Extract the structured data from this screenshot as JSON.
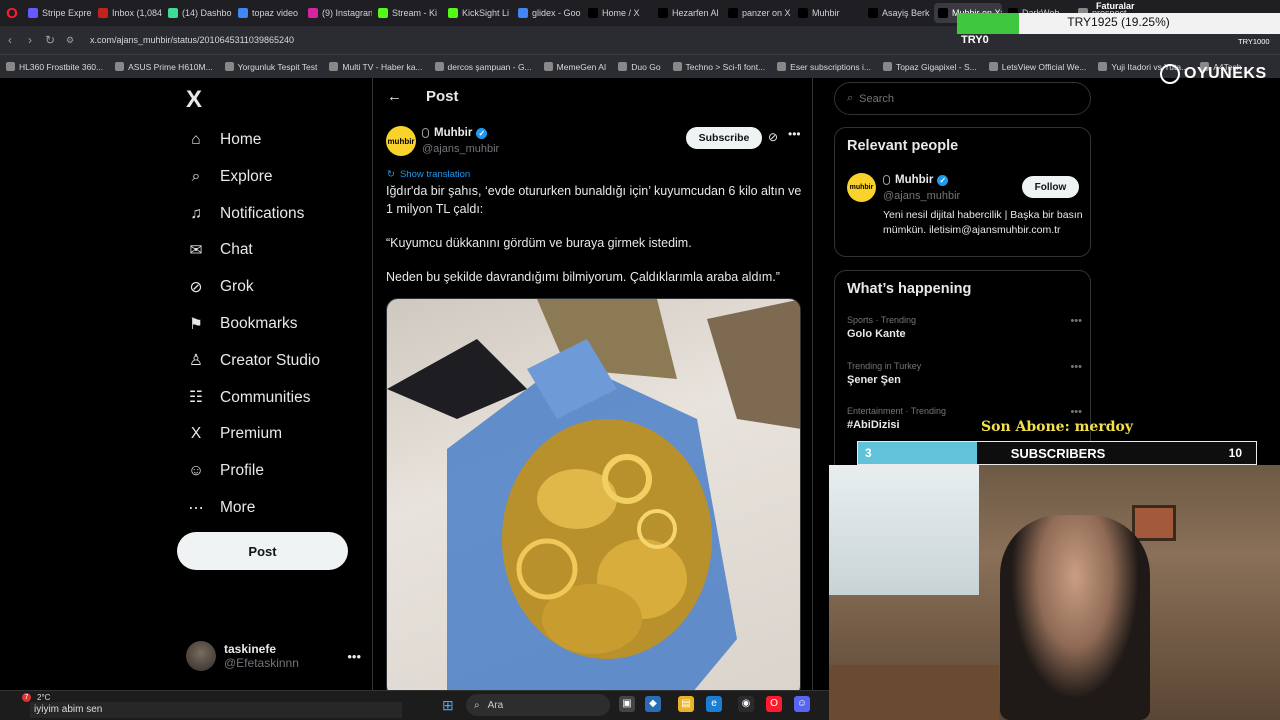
{
  "browser": {
    "tabs": [
      {
        "label": "Stripe Expre",
        "color": "#635bff"
      },
      {
        "label": "Inbox (1,084",
        "color": "#c5221f"
      },
      {
        "label": "(14) Dashbo",
        "color": "#3ddc97"
      },
      {
        "label": "topaz video",
        "color": "#4285f4"
      },
      {
        "label": "(9) Instagran",
        "color": "#d6249f"
      },
      {
        "label": "Stream - Ki",
        "color": "#53fc18"
      },
      {
        "label": "KickSight Li",
        "color": "#53fc18"
      },
      {
        "label": "glidex - Goo",
        "color": "#4285f4"
      },
      {
        "label": "Home / X",
        "color": "#000000"
      },
      {
        "label": "Hezarfen Al",
        "color": "#000000"
      },
      {
        "label": "panzer on X",
        "color": "#000000"
      },
      {
        "label": "Muhbir",
        "color": "#000000"
      },
      {
        "label": "Asayiş Berk",
        "color": "#000000"
      },
      {
        "label": "Muhbir on X: \"Iğ",
        "color": "#000000",
        "active": true
      },
      {
        "label": "DarkWeb",
        "color": "#000000"
      },
      {
        "label": "prospect",
        "color": "#888888"
      }
    ],
    "url": "x.com/ajans_muhbir/status/2010645311039865240",
    "bookmarks": [
      "HL360 Frostbite 360...",
      "ASUS Prime H610M...",
      "Yorgunluk Tespit Test",
      "Multi TV - Haber ka...",
      "dercos şampuan - G...",
      "MemeGen AI",
      "Duo Go",
      "Techno > Sci-fi font...",
      "Eser subscriptions i...",
      "Topaz Gigapixel - S...",
      "LetsView Official We...",
      "Yuji Itadori vs Yuta...",
      "A4Tech"
    ]
  },
  "nav": {
    "logo": "X",
    "items": [
      {
        "label": "Home",
        "icon": "home-icon",
        "glyph": "⌂"
      },
      {
        "label": "Explore",
        "icon": "search-icon",
        "glyph": "⌕"
      },
      {
        "label": "Notifications",
        "icon": "bell-icon",
        "glyph": "♫"
      },
      {
        "label": "Chat",
        "icon": "mail-icon",
        "glyph": "✉"
      },
      {
        "label": "Grok",
        "icon": "grok-icon",
        "glyph": "⊘"
      },
      {
        "label": "Bookmarks",
        "icon": "bookmark-icon",
        "glyph": "⚑"
      },
      {
        "label": "Creator Studio",
        "icon": "creator-studio-icon",
        "glyph": "♙"
      },
      {
        "label": "Communities",
        "icon": "communities-icon",
        "glyph": "☷"
      },
      {
        "label": "Premium",
        "icon": "premium-icon",
        "glyph": "X"
      },
      {
        "label": "Profile",
        "icon": "profile-icon",
        "glyph": "☺"
      },
      {
        "label": "More",
        "icon": "more-circle-icon",
        "glyph": "⋯"
      }
    ],
    "post_label": "Post",
    "account": {
      "name": "taskinefe",
      "handle": "@Efetaskinnn"
    }
  },
  "post": {
    "header": "Post",
    "author": {
      "avatar_text": "muhbir",
      "name": "Muhbir",
      "handle": "@ajans_muhbir"
    },
    "subscribe_label": "Subscribe",
    "show_translation": "Show translation",
    "paragraphs": [
      "Iğdır'da bir şahıs, ‘evde otururken bunaldığı için’ kuyumcudan 6 kilo altın ve 1 milyon TL çaldı:",
      "“Kuyumcu dükkanını gördüm ve buraya girmek istedim.",
      "Neden bu şekilde davrandığımı bilmiyorum. Çaldıklarımla araba aldım.”"
    ]
  },
  "sidebar": {
    "search_placeholder": "Search",
    "relevant_title": "Relevant people",
    "person": {
      "avatar_text": "muhbir",
      "name": "Muhbir",
      "handle": "@ajans_muhbir",
      "follow_label": "Follow",
      "bio": "Yeni nesil dijital habercilik | Başka bir basın mümkün. iletisim@ajansmuhbir.com.tr"
    },
    "happening_title": "What’s happening",
    "trends": [
      {
        "meta": "Sports · Trending",
        "name": "Golo Kante"
      },
      {
        "meta": "Trending in Turkey",
        "name": "Şener Şen"
      },
      {
        "meta": "Entertainment · Trending",
        "name": "#AbiDizisi"
      }
    ]
  },
  "overlay": {
    "try_goal": "TRY1925 (19.25%)",
    "try_goal_fraction": 0.1925,
    "try_current": "TRY0",
    "faturalar": "Faturalar",
    "try_right": "TRY1000",
    "brand": "OYUNEKS",
    "son_abone": "Son Abone: merdoy",
    "subs_current": "3",
    "subs_label": "SUBSCRIBERS",
    "subs_goal": "10",
    "subs_fraction": 0.3
  },
  "taskbar": {
    "weather_badge": "7",
    "weather": "2°C",
    "chat_message": "iyiyim abim sen",
    "search_label": "Ara"
  }
}
